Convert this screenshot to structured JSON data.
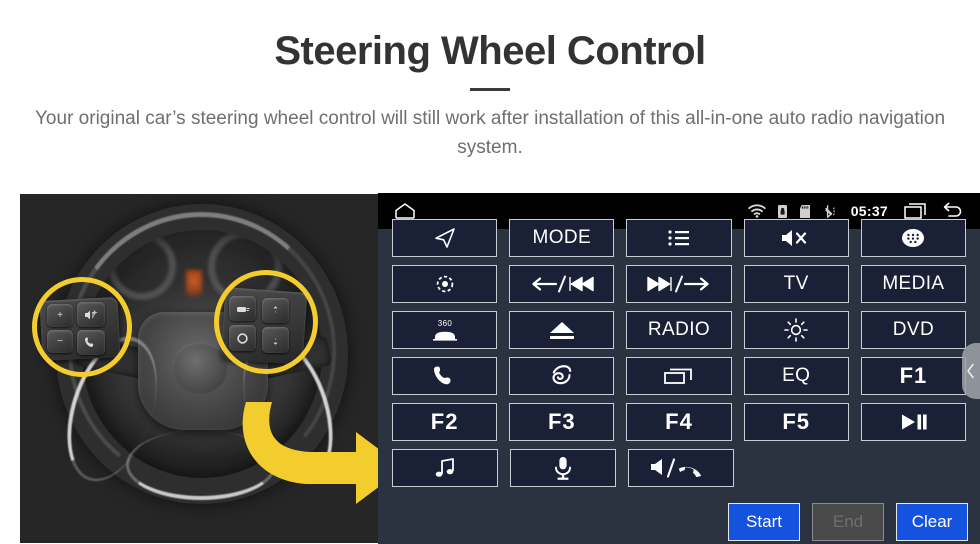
{
  "header": {
    "title": "Steering Wheel Control",
    "subtitle": "Your original car’s steering wheel control will still work after installation of this all-in-one auto radio navigation system."
  },
  "photo": {
    "alt": "Grayscale photo of a car steering wheel with two yellow circles highlighting the left and right steering-wheel control button pods, and a yellow arrow pointing right toward the radio unit",
    "highlight_color": "#F3CC2E",
    "arrow_color": "#F3CC2E"
  },
  "radio": {
    "panel_bg": "#2b3240",
    "button_bg": "#1a2137",
    "button_border": "#c9ccd4",
    "accent": "#1452e0",
    "statusbar": {
      "home_icon": "home-icon",
      "time": "05:37",
      "icons": [
        "wifi-icon",
        "usb-lock-icon",
        "sd-card-icon",
        "bluetooth-icon"
      ],
      "recents_icon": "recents-icon",
      "back_icon": "back-icon"
    },
    "rows": [
      [
        {
          "label": "",
          "icon": "navigation-arrow-icon",
          "name": "btn-navigation"
        },
        {
          "label": "MODE",
          "icon": "",
          "name": "btn-mode"
        },
        {
          "label": "",
          "icon": "list-menu-icon",
          "name": "btn-menu"
        },
        {
          "label": "",
          "icon": "mute-icon",
          "name": "btn-mute"
        },
        {
          "label": "",
          "icon": "apps-grid-icon",
          "name": "btn-apps"
        }
      ],
      [
        {
          "label": "",
          "icon": "settings-gear-icon",
          "name": "btn-settings"
        },
        {
          "label": "",
          "icon": "previous-track-icon",
          "name": "btn-previous"
        },
        {
          "label": "",
          "icon": "next-track-icon",
          "name": "btn-next"
        },
        {
          "label": "TV",
          "icon": "",
          "name": "btn-tv"
        },
        {
          "label": "MEDIA",
          "icon": "",
          "name": "btn-media"
        }
      ],
      [
        {
          "label": "",
          "icon": "camera-360-icon",
          "name": "btn-360-camera"
        },
        {
          "label": "",
          "icon": "eject-icon",
          "name": "btn-eject"
        },
        {
          "label": "RADIO",
          "icon": "",
          "name": "btn-radio"
        },
        {
          "label": "",
          "icon": "brightness-icon",
          "name": "btn-brightness"
        },
        {
          "label": "DVD",
          "icon": "",
          "name": "btn-dvd"
        }
      ],
      [
        {
          "label": "",
          "icon": "phone-icon",
          "name": "btn-phone"
        },
        {
          "label": "",
          "icon": "spiral-icon",
          "name": "btn-spiral"
        },
        {
          "label": "",
          "icon": "window-switch-icon",
          "name": "btn-window-switch"
        },
        {
          "label": "EQ",
          "icon": "",
          "name": "btn-eq"
        },
        {
          "label": "F1",
          "icon": "",
          "name": "btn-f1"
        }
      ],
      [
        {
          "label": "F2",
          "icon": "",
          "name": "btn-f2"
        },
        {
          "label": "F3",
          "icon": "",
          "name": "btn-f3"
        },
        {
          "label": "F4",
          "icon": "",
          "name": "btn-f4"
        },
        {
          "label": "F5",
          "icon": "",
          "name": "btn-f5"
        },
        {
          "label": "",
          "icon": "play-pause-icon",
          "name": "btn-play-pause"
        }
      ],
      [
        {
          "label": "",
          "icon": "music-note-icon",
          "name": "btn-music"
        },
        {
          "label": "",
          "icon": "microphone-icon",
          "name": "btn-microphone"
        },
        {
          "label": "",
          "icon": "volume-hangup-icon",
          "name": "btn-volume-hangup"
        }
      ]
    ],
    "footer": {
      "start_label": "Start",
      "end_label": "End",
      "clear_label": "Clear",
      "start_state": "enabled",
      "end_state": "disabled",
      "clear_state": "enabled"
    },
    "scroll_handle_icon": "chevron-left-icon"
  }
}
